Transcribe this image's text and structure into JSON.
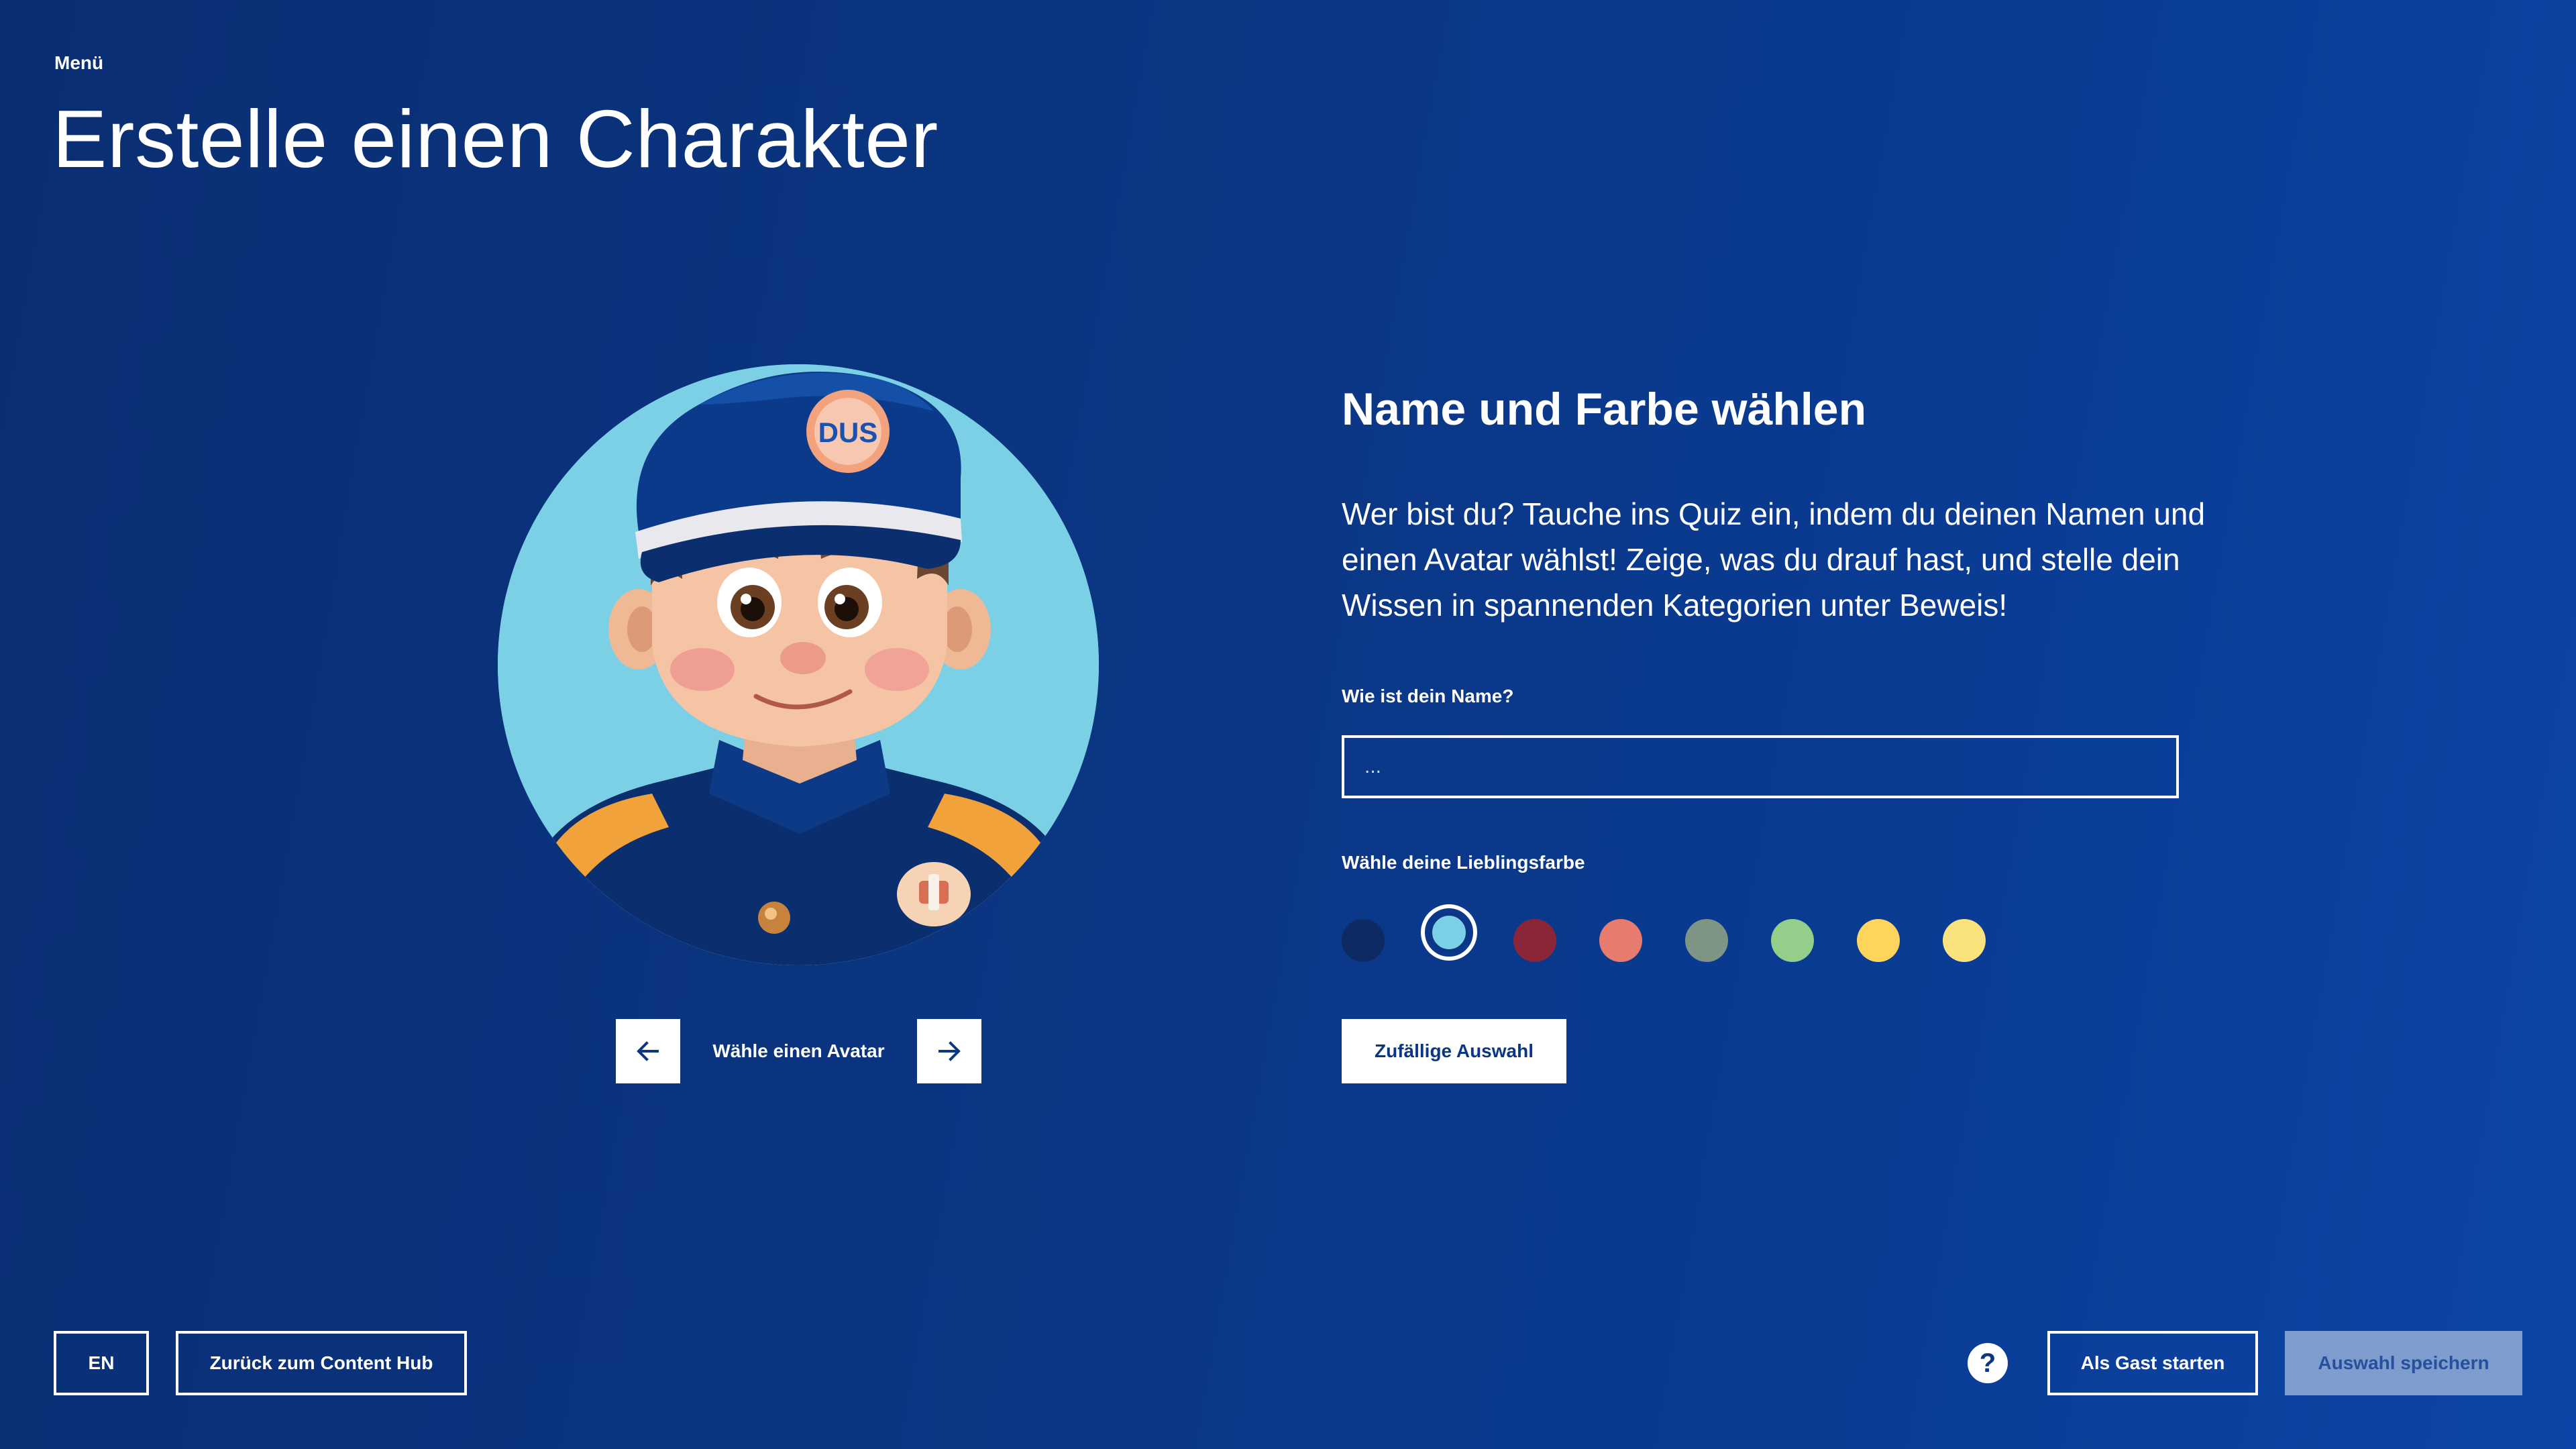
{
  "header": {
    "menu_label": "Menü",
    "title": "Erstelle einen Charakter"
  },
  "avatar": {
    "badge_text": "DUS",
    "nav_label": "Wähle einen Avatar",
    "prev_icon": "arrow-left-icon",
    "next_icon": "arrow-right-icon"
  },
  "panel": {
    "title": "Name und Farbe wählen",
    "description": "Wer bist du? Tauche ins Quiz ein, indem du deinen Namen und einen Avatar wählst! Zeige, was du drauf hast, und stelle dein Wissen in spannenden Kategorien unter Beweis!",
    "name_label": "Wie ist dein Name?",
    "name_placeholder": "...",
    "name_value": "",
    "color_label": "Wähle deine Lieblingsfarbe",
    "colors": [
      "#0d2a63",
      "#7bd0e6",
      "#8b2639",
      "#e77b6e",
      "#7e9484",
      "#93cf8b",
      "#fdd45c",
      "#fae27c"
    ],
    "selected_color_index": 1,
    "random_button": "Zufällige Auswahl"
  },
  "footer": {
    "language_button": "EN",
    "back_button": "Zurück zum Content Hub",
    "help_icon": "question-mark-icon",
    "help_symbol": "?",
    "guest_button": "Als Gast starten",
    "save_button": "Auswahl speichern"
  }
}
